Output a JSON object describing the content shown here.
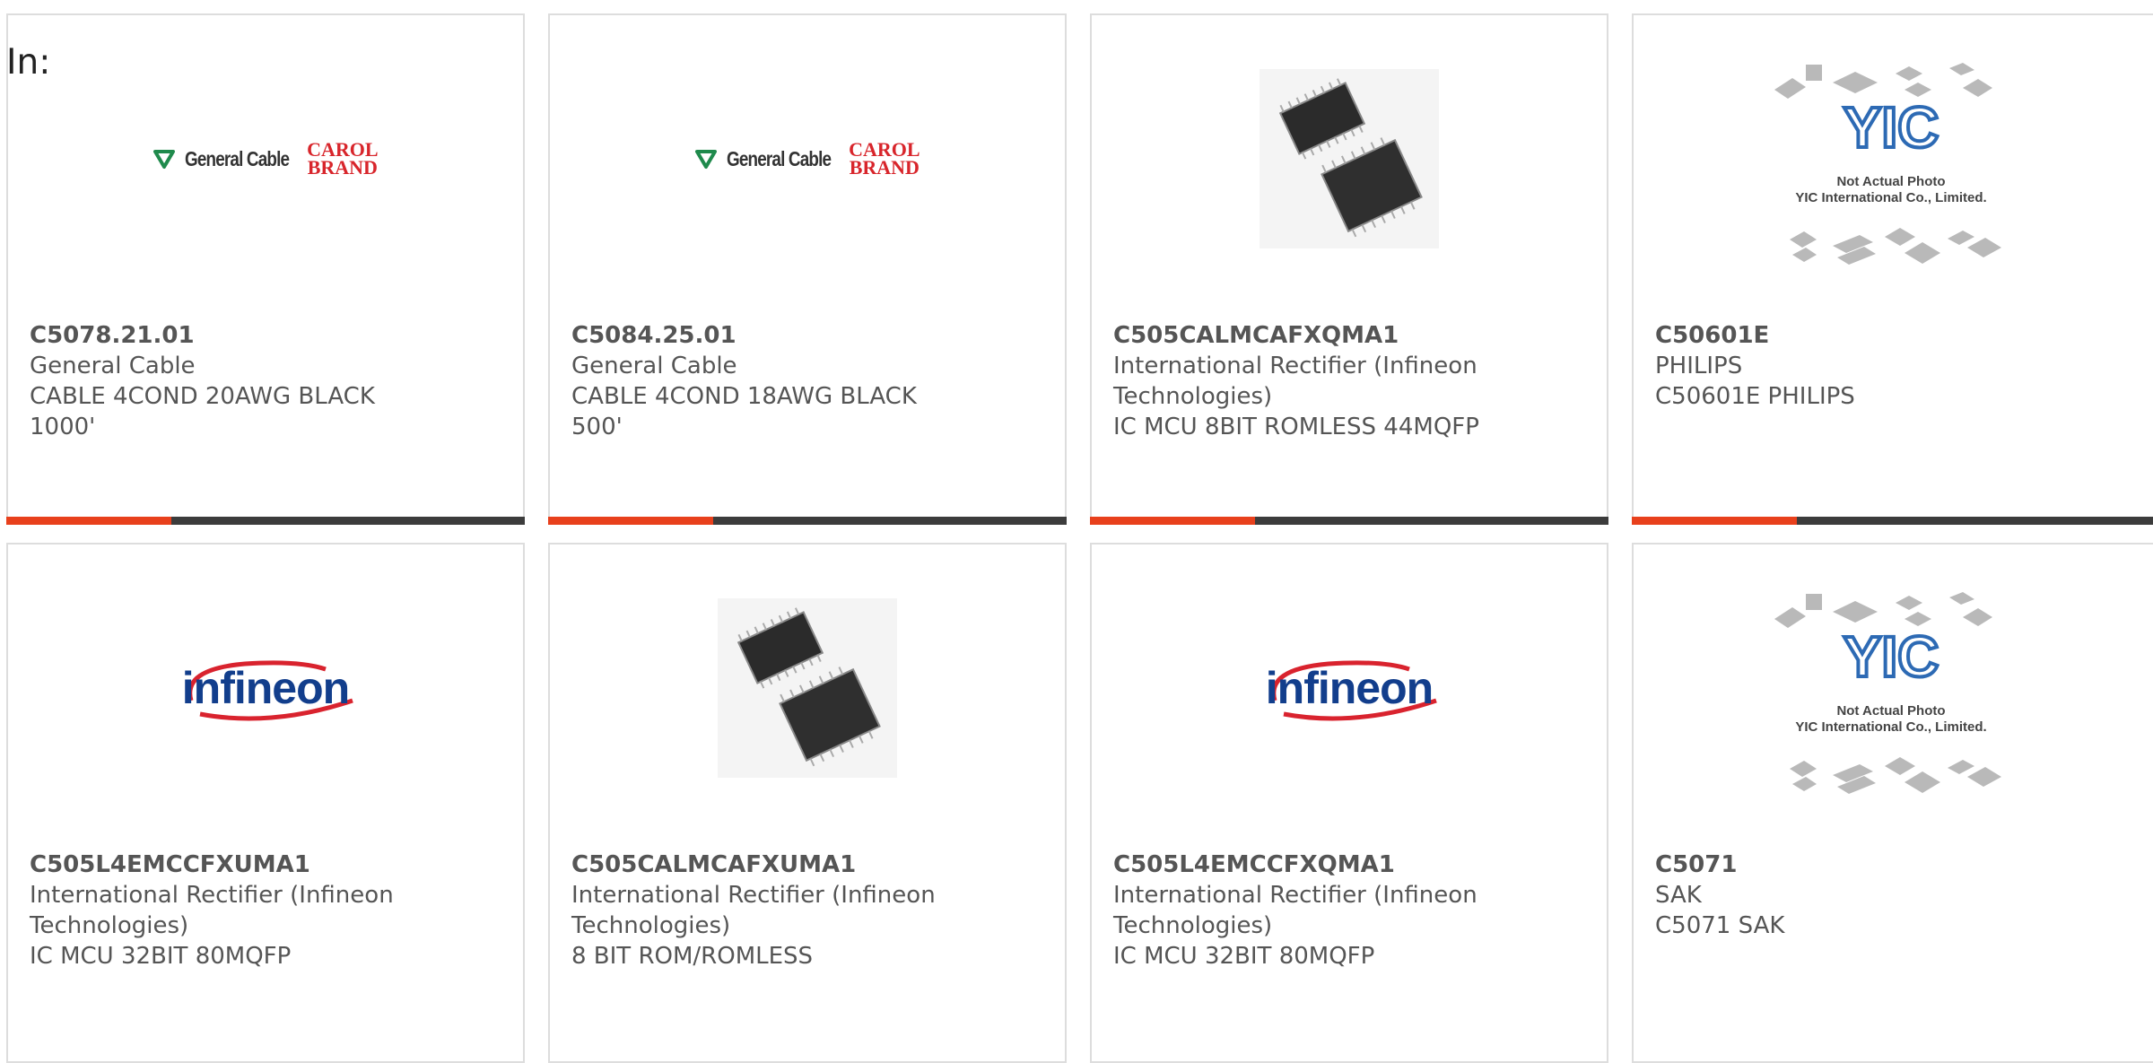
{
  "header": {
    "label": "In:"
  },
  "colors": {
    "accent": "#e8401c",
    "bar": "#3c3c3c",
    "text": "#555555",
    "border": "#dddddd"
  },
  "products": [
    {
      "part_number": "C5078.21.01",
      "manufacturer": "General Cable",
      "description": "CABLE 4COND 20AWG BLACK 1000'",
      "image_icon": "general-cable-logo"
    },
    {
      "part_number": "C5084.25.01",
      "manufacturer": "General Cable",
      "description": "CABLE 4COND 18AWG BLACK 500'",
      "image_icon": "general-cable-logo"
    },
    {
      "part_number": "C505CALMCAFXQMA1",
      "manufacturer": "International Rectifier (Infineon Technologies)",
      "description": "IC MCU 8BIT ROMLESS 44MQFP",
      "image_icon": "ic-chip-photo"
    },
    {
      "part_number": "C50601E",
      "manufacturer": "PHILIPS",
      "description": "C50601E PHILIPS",
      "image_icon": "yic-placeholder"
    },
    {
      "part_number": "C505L4EMCCFXUMA1",
      "manufacturer": "International Rectifier (Infineon Technologies)",
      "description": "IC MCU 32BIT 80MQFP",
      "image_icon": "infineon-logo"
    },
    {
      "part_number": "C505CALMCAFXUMA1",
      "manufacturer": "International Rectifier (Infineon Technologies)",
      "description": "8 BIT ROM/ROMLESS",
      "image_icon": "ic-chip-photo"
    },
    {
      "part_number": "C505L4EMCCFXQMA1",
      "manufacturer": "International Rectifier (Infineon Technologies)",
      "description": "IC MCU 32BIT 80MQFP",
      "image_icon": "infineon-logo"
    },
    {
      "part_number": "C5071",
      "manufacturer": "SAK",
      "description": "C5071 SAK",
      "image_icon": "yic-placeholder"
    }
  ],
  "logos": {
    "general_cable": {
      "name": "General Cable",
      "brand_top": "CAROL",
      "brand_bottom": "BRAND"
    },
    "infineon": {
      "name": "infineon"
    },
    "yic": {
      "mark": "YIC",
      "caption_1": "Not Actual Photo",
      "caption_2": "YIC International Co., Limited."
    }
  }
}
